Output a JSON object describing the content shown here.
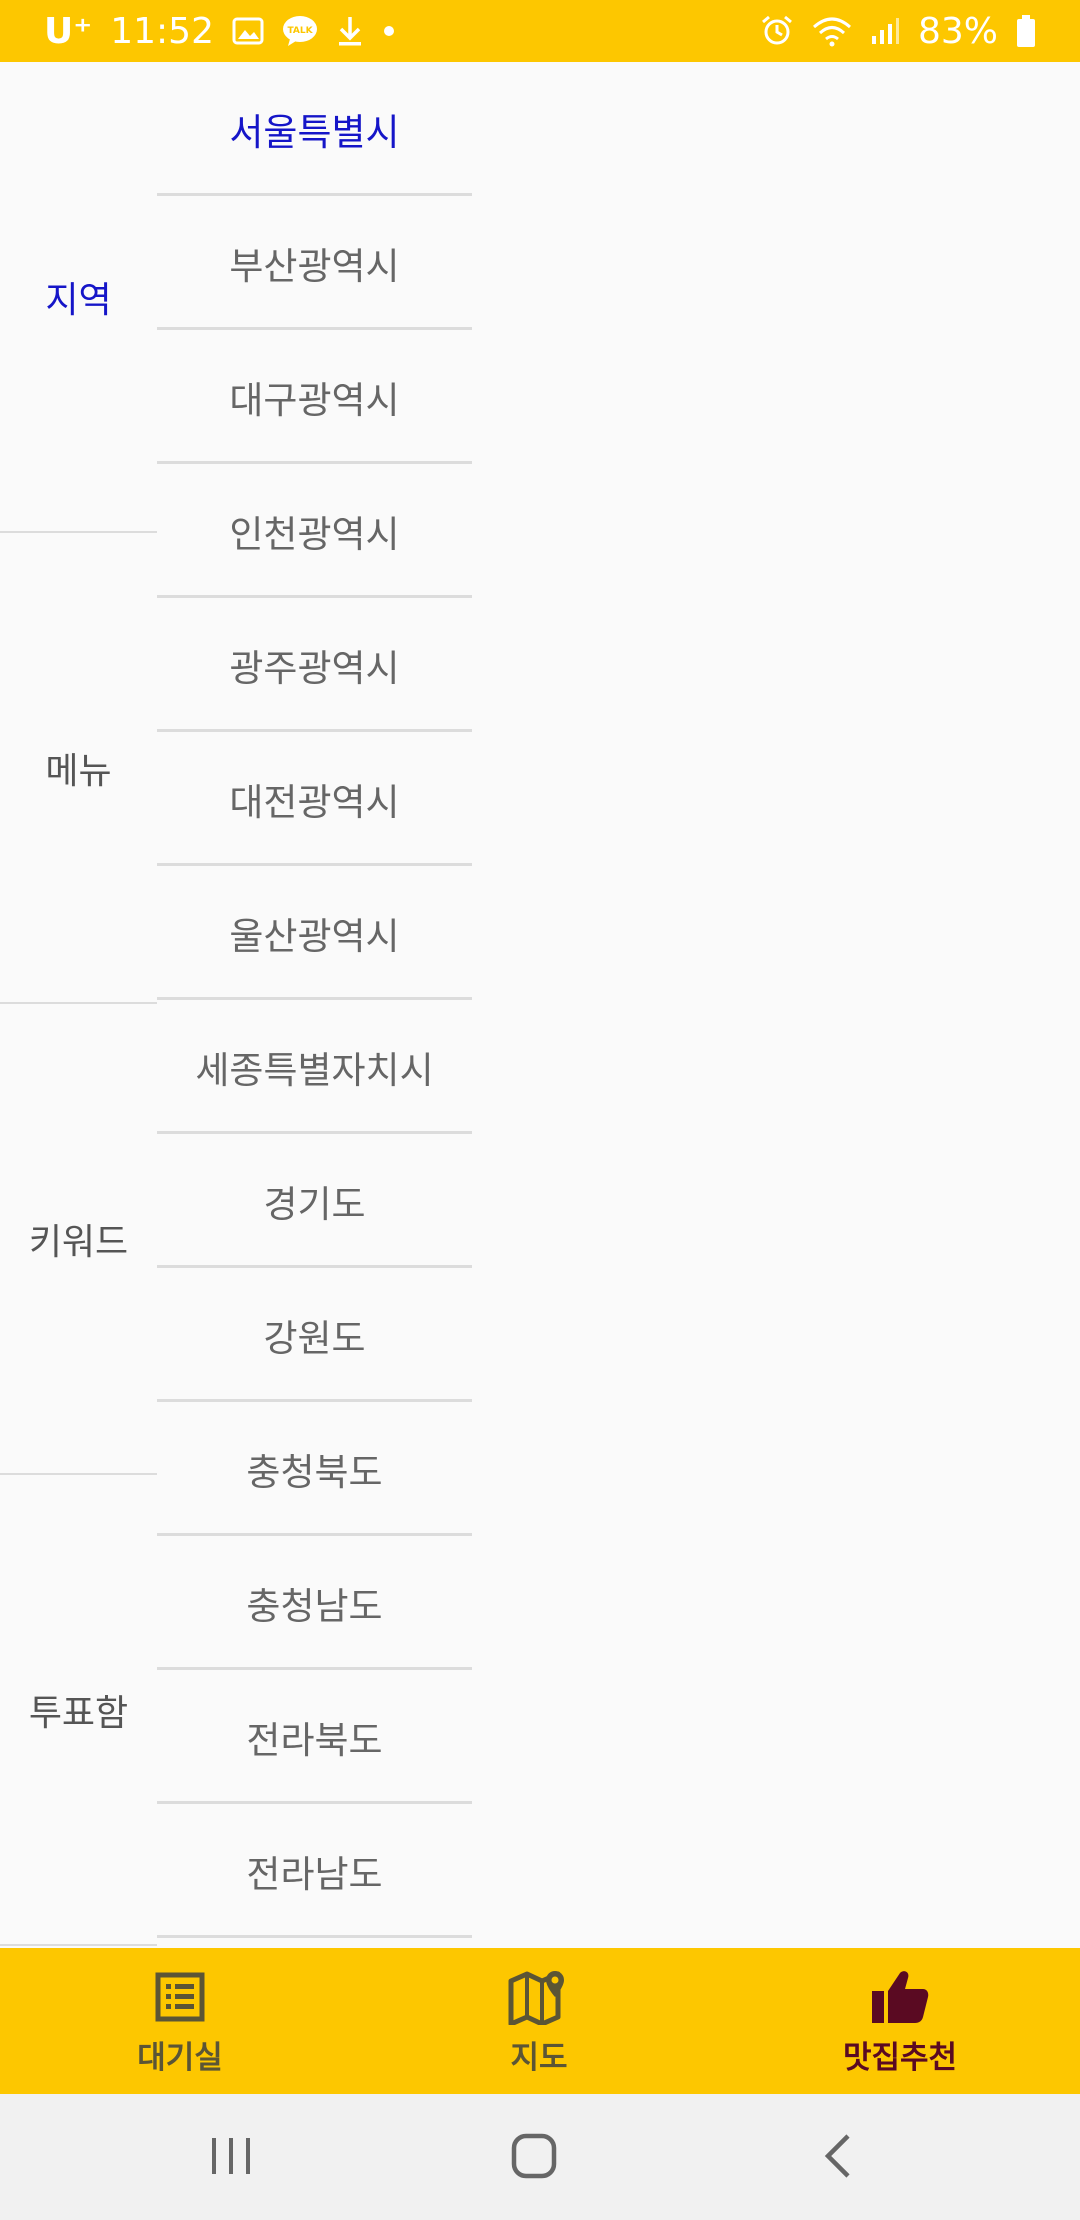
{
  "status_bar": {
    "carrier": "U⁺",
    "time": "11:52",
    "battery": "83%",
    "icons": [
      "gallery-icon",
      "kakaotalk-icon",
      "download-icon",
      "dot-icon",
      "alarm-icon",
      "wifi-icon",
      "signal-icon",
      "battery-icon"
    ],
    "color": "#fdc700"
  },
  "categories": [
    {
      "label": "지역",
      "active": true
    },
    {
      "label": "메뉴",
      "active": false
    },
    {
      "label": "키워드",
      "active": false
    },
    {
      "label": "투표함",
      "active": false
    }
  ],
  "regions": [
    {
      "label": "서울특별시",
      "active": true
    },
    {
      "label": "부산광역시",
      "active": false
    },
    {
      "label": "대구광역시",
      "active": false
    },
    {
      "label": "인천광역시",
      "active": false
    },
    {
      "label": "광주광역시",
      "active": false
    },
    {
      "label": "대전광역시",
      "active": false
    },
    {
      "label": "울산광역시",
      "active": false
    },
    {
      "label": "세종특별자치시",
      "active": false
    },
    {
      "label": "경기도",
      "active": false
    },
    {
      "label": "강원도",
      "active": false
    },
    {
      "label": "충청북도",
      "active": false
    },
    {
      "label": "충청남도",
      "active": false
    },
    {
      "label": "전라북도",
      "active": false
    },
    {
      "label": "전라남도",
      "active": false
    }
  ],
  "bottom_nav": [
    {
      "label": "대기실",
      "icon": "list-icon",
      "active": false
    },
    {
      "label": "지도",
      "icon": "map-icon",
      "active": false
    },
    {
      "label": "맛집추천",
      "icon": "thumbs-up-icon",
      "active": true
    }
  ],
  "colors": {
    "accent_yellow": "#fdc700",
    "active_blue": "#1515c8",
    "active_nav": "#5a0a22"
  }
}
